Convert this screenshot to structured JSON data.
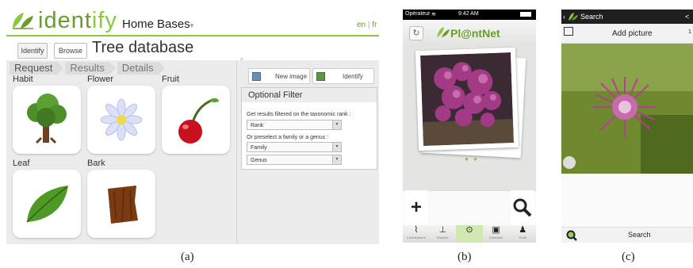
{
  "panel_a": {
    "logo_prefix": "ident",
    "logo_suffix": "ify",
    "nav": {
      "home": "Home",
      "bases": "Bases"
    },
    "lang": {
      "en": "en",
      "sep": "|",
      "fr": "fr"
    },
    "buttons": {
      "identify": "Identify",
      "browse": "Browse"
    },
    "title": "Tree database",
    "breadcrumbs": [
      "Request",
      "Results",
      "Details"
    ],
    "categories": [
      "Habit",
      "Flower",
      "Fruit",
      "Leaf",
      "Bark"
    ],
    "actions": {
      "new_image": "New image",
      "identify": "Identify"
    },
    "filter": {
      "heading": "Optional Filter",
      "rank_hint": "Get results filtered on the taxonomic rank :",
      "rank_value": "Rank",
      "family_hint": "Or preselect a family or a genus :",
      "family_value": "Family",
      "genus_value": "Genus"
    },
    "caption": "(a)"
  },
  "panel_b": {
    "carrier": "Opérateur",
    "time": "9:42 AM",
    "app_name": "Pl@ntNet",
    "tabs": [
      "Contributions",
      "Explorer",
      "",
      "Collection",
      "Profil"
    ],
    "caption": "(b)"
  },
  "panel_c": {
    "back_title": "Search",
    "add_picture": "Add picture",
    "count": "1",
    "search_label": "Search",
    "caption": "(c)"
  },
  "colors": {
    "accent": "#8dc63f",
    "brand_dark": "#6a9c2b",
    "flower_purple": "#b0418e"
  }
}
